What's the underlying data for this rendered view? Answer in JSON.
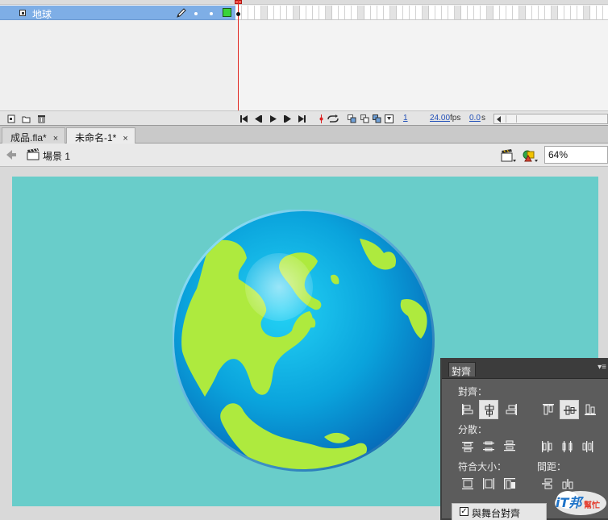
{
  "timeline": {
    "layer_name": "地球",
    "layer_color": "#39d43a",
    "playhead_color": "#e0271f",
    "current_frame": "1",
    "fps": "24.00",
    "fps_unit": "fps",
    "elapsed": "0.0",
    "elapsed_unit": "s"
  },
  "tabs": [
    {
      "label": "成品.fla*",
      "close": "×"
    },
    {
      "label": "未命名-1*",
      "close": "×"
    }
  ],
  "editbar": {
    "scene_label": "場景 1",
    "zoom": "64%"
  },
  "stage": {
    "background": "#69cdca",
    "ocean_color": "#0a93d8",
    "land_color": "#aeea3e"
  },
  "align_panel": {
    "tab_label": "對齊",
    "menu_icon": "panel-menu-icon",
    "align_label": "對齊：",
    "distribute_label": "分散：",
    "match_size_label": "符合大小：",
    "spacing_label": "間距：",
    "stage_align_label": "與舞台對齊",
    "stage_align_checked": true
  },
  "watermark": {
    "brand_text": "iT邦",
    "brand_subtext": "幫忙"
  }
}
